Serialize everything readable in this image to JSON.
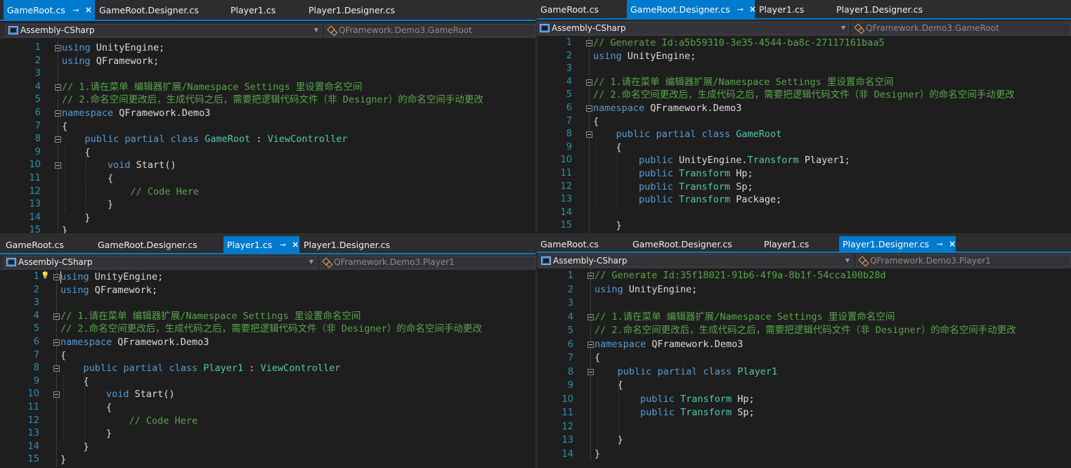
{
  "panes": [
    {
      "id": "top-left",
      "tabs": [
        {
          "label": "GameRoot.cs",
          "active": true
        },
        {
          "label": "GameRoot.Designer.cs",
          "active": false
        },
        {
          "label": "Player1.cs",
          "active": false
        },
        {
          "label": "Player1.Designer.cs",
          "active": false
        }
      ],
      "project_dropdown": "Assembly-CSharp",
      "class_dropdown": "QFramework.Demo3.GameRoot",
      "lines": [
        {
          "n": "1",
          "tokens": [
            [
              "kw",
              "using"
            ],
            [
              "plain",
              " UnityEngine;"
            ]
          ]
        },
        {
          "n": "2",
          "tokens": [
            [
              "kw",
              "using"
            ],
            [
              "plain",
              " QFramework;"
            ]
          ]
        },
        {
          "n": "3",
          "tokens": []
        },
        {
          "n": "4",
          "tokens": [
            [
              "cmt",
              "// 1.请在菜单 编辑器扩展/Namespace Settings 里设置命名空间"
            ]
          ]
        },
        {
          "n": "5",
          "tokens": [
            [
              "cmt",
              "// 2.命名空间更改后，生成代码之后，需要把逻辑代码文件（非 Designer）的命名空间手动更改"
            ]
          ]
        },
        {
          "n": "6",
          "tokens": [
            [
              "kw",
              "namespace"
            ],
            [
              "plain",
              " QFramework.Demo3"
            ]
          ]
        },
        {
          "n": "7",
          "tokens": [
            [
              "plain",
              "{"
            ]
          ]
        },
        {
          "n": "8",
          "tokens": [
            [
              "plain",
              "    "
            ],
            [
              "kw",
              "public"
            ],
            [
              "plain",
              " "
            ],
            [
              "kw",
              "partial"
            ],
            [
              "plain",
              " "
            ],
            [
              "kw",
              "class"
            ],
            [
              "plain",
              " "
            ],
            [
              "type",
              "GameRoot"
            ],
            [
              "plain",
              " : "
            ],
            [
              "type",
              "ViewController"
            ]
          ]
        },
        {
          "n": "9",
          "tokens": [
            [
              "plain",
              "    {"
            ]
          ]
        },
        {
          "n": "10",
          "tokens": [
            [
              "plain",
              "        "
            ],
            [
              "kw",
              "void"
            ],
            [
              "plain",
              " Start()"
            ]
          ]
        },
        {
          "n": "11",
          "tokens": [
            [
              "plain",
              "        {"
            ]
          ]
        },
        {
          "n": "12",
          "tokens": [
            [
              "plain",
              "            "
            ],
            [
              "cmt",
              "// Code Here"
            ]
          ]
        },
        {
          "n": "13",
          "tokens": [
            [
              "plain",
              "        }"
            ]
          ]
        },
        {
          "n": "14",
          "tokens": [
            [
              "plain",
              "    }"
            ]
          ]
        },
        {
          "n": "15",
          "tokens": [
            [
              "plain",
              "}"
            ]
          ]
        }
      ]
    },
    {
      "id": "top-right",
      "tabs": [
        {
          "label": "GameRoot.cs",
          "active": false
        },
        {
          "label": "GameRoot.Designer.cs",
          "active": true
        },
        {
          "label": "Player1.cs",
          "active": false
        },
        {
          "label": "Player1.Designer.cs",
          "active": false
        }
      ],
      "project_dropdown": "Assembly-CSharp",
      "class_dropdown": "QFramework.Demo3.GameRoot",
      "lines": [
        {
          "n": "1",
          "tokens": [
            [
              "cmt",
              "// Generate Id:a5b59310-3e35-4544-ba8c-27117161baa5"
            ]
          ]
        },
        {
          "n": "2",
          "tokens": [
            [
              "kw",
              "using"
            ],
            [
              "plain",
              " UnityEngine;"
            ]
          ]
        },
        {
          "n": "3",
          "tokens": []
        },
        {
          "n": "4",
          "tokens": [
            [
              "cmt",
              "// 1.请在菜单 编辑器扩展/Namespace Settings 里设置命名空间"
            ]
          ]
        },
        {
          "n": "5",
          "tokens": [
            [
              "cmt",
              "// 2.命名空间更改后，生成代码之后，需要把逻辑代码文件（非 Designer）的命名空间手动更改"
            ]
          ]
        },
        {
          "n": "6",
          "tokens": [
            [
              "kw",
              "namespace"
            ],
            [
              "plain",
              " QFramework.Demo3"
            ]
          ]
        },
        {
          "n": "7",
          "tokens": [
            [
              "plain",
              "{"
            ]
          ]
        },
        {
          "n": "8",
          "tokens": [
            [
              "plain",
              "    "
            ],
            [
              "kw",
              "public"
            ],
            [
              "plain",
              " "
            ],
            [
              "kw",
              "partial"
            ],
            [
              "plain",
              " "
            ],
            [
              "kw",
              "class"
            ],
            [
              "plain",
              " "
            ],
            [
              "type",
              "GameRoot"
            ]
          ]
        },
        {
          "n": "9",
          "tokens": [
            [
              "plain",
              "    {"
            ]
          ]
        },
        {
          "n": "10",
          "tokens": [
            [
              "plain",
              "        "
            ],
            [
              "kw",
              "public"
            ],
            [
              "plain",
              " UnityEngine."
            ],
            [
              "type",
              "Transform"
            ],
            [
              "plain",
              " Player1;"
            ]
          ]
        },
        {
          "n": "11",
          "tokens": [
            [
              "plain",
              "        "
            ],
            [
              "kw",
              "public"
            ],
            [
              "plain",
              " "
            ],
            [
              "type",
              "Transform"
            ],
            [
              "plain",
              " Hp;"
            ]
          ]
        },
        {
          "n": "12",
          "tokens": [
            [
              "plain",
              "        "
            ],
            [
              "kw",
              "public"
            ],
            [
              "plain",
              " "
            ],
            [
              "type",
              "Transform"
            ],
            [
              "plain",
              " Sp;"
            ]
          ]
        },
        {
          "n": "13",
          "tokens": [
            [
              "plain",
              "        "
            ],
            [
              "kw",
              "public"
            ],
            [
              "plain",
              " "
            ],
            [
              "type",
              "Transform"
            ],
            [
              "plain",
              " Package;"
            ]
          ]
        },
        {
          "n": "14",
          "tokens": []
        },
        {
          "n": "15",
          "tokens": [
            [
              "plain",
              "    }"
            ]
          ]
        }
      ]
    },
    {
      "id": "bottom-left",
      "tabs": [
        {
          "label": "GameRoot.cs",
          "active": false
        },
        {
          "label": "GameRoot.Designer.cs",
          "active": false
        },
        {
          "label": "Player1.cs",
          "active": true
        },
        {
          "label": "Player1.Designer.cs",
          "active": false
        }
      ],
      "project_dropdown": "Assembly-CSharp",
      "class_dropdown": "QFramework.Demo3.Player1",
      "lines": [
        {
          "n": "1",
          "tokens": [
            [
              "kw",
              "using"
            ],
            [
              "plain",
              " UnityEngine;"
            ]
          ]
        },
        {
          "n": "2",
          "tokens": [
            [
              "kw",
              "using"
            ],
            [
              "plain",
              " QFramework;"
            ]
          ]
        },
        {
          "n": "3",
          "tokens": []
        },
        {
          "n": "4",
          "tokens": [
            [
              "cmt",
              "// 1.请在菜单 编辑器扩展/Namespace Settings 里设置命名空间"
            ]
          ]
        },
        {
          "n": "5",
          "tokens": [
            [
              "cmt",
              "// 2.命名空间更改后，生成代码之后，需要把逻辑代码文件（非 Designer）的命名空间手动更改"
            ]
          ]
        },
        {
          "n": "6",
          "tokens": [
            [
              "kw",
              "namespace"
            ],
            [
              "plain",
              " QFramework.Demo3"
            ]
          ]
        },
        {
          "n": "7",
          "tokens": [
            [
              "plain",
              "{"
            ]
          ]
        },
        {
          "n": "8",
          "tokens": [
            [
              "plain",
              "    "
            ],
            [
              "kw",
              "public"
            ],
            [
              "plain",
              " "
            ],
            [
              "kw",
              "partial"
            ],
            [
              "plain",
              " "
            ],
            [
              "kw",
              "class"
            ],
            [
              "plain",
              " "
            ],
            [
              "type",
              "Player1"
            ],
            [
              "plain",
              " : "
            ],
            [
              "type",
              "ViewController"
            ]
          ]
        },
        {
          "n": "9",
          "tokens": [
            [
              "plain",
              "    {"
            ]
          ]
        },
        {
          "n": "10",
          "tokens": [
            [
              "plain",
              "        "
            ],
            [
              "kw",
              "void"
            ],
            [
              "plain",
              " Start()"
            ]
          ]
        },
        {
          "n": "11",
          "tokens": [
            [
              "plain",
              "        {"
            ]
          ]
        },
        {
          "n": "12",
          "tokens": [
            [
              "plain",
              "            "
            ],
            [
              "cmt",
              "// Code Here"
            ]
          ]
        },
        {
          "n": "13",
          "tokens": [
            [
              "plain",
              "        }"
            ]
          ]
        },
        {
          "n": "14",
          "tokens": [
            [
              "plain",
              "    }"
            ]
          ]
        },
        {
          "n": "15",
          "tokens": [
            [
              "plain",
              "}"
            ]
          ]
        }
      ]
    },
    {
      "id": "bottom-right",
      "tabs": [
        {
          "label": "GameRoot.cs",
          "active": false
        },
        {
          "label": "GameRoot.Designer.cs",
          "active": false
        },
        {
          "label": "Player1.cs",
          "active": false
        },
        {
          "label": "Player1.Designer.cs",
          "active": true
        }
      ],
      "project_dropdown": "Assembly-CSharp",
      "class_dropdown": "QFramework.Demo3.Player1",
      "lines": [
        {
          "n": "1",
          "tokens": [
            [
              "cmt",
              "// Generate Id:35f18021-91b6-4f9a-8b1f-54cca100b28d"
            ]
          ]
        },
        {
          "n": "2",
          "tokens": [
            [
              "kw",
              "using"
            ],
            [
              "plain",
              " UnityEngine;"
            ]
          ]
        },
        {
          "n": "3",
          "tokens": []
        },
        {
          "n": "4",
          "tokens": [
            [
              "cmt",
              "// 1.请在菜单 编辑器扩展/Namespace Settings 里设置命名空间"
            ]
          ]
        },
        {
          "n": "5",
          "tokens": [
            [
              "cmt",
              "// 2.命名空间更改后，生成代码之后，需要把逻辑代码文件（非 Designer）的命名空间手动更改"
            ]
          ]
        },
        {
          "n": "6",
          "tokens": [
            [
              "kw",
              "namespace"
            ],
            [
              "plain",
              " QFramework.Demo3"
            ]
          ]
        },
        {
          "n": "7",
          "tokens": [
            [
              "plain",
              "{"
            ]
          ]
        },
        {
          "n": "8",
          "tokens": [
            [
              "plain",
              "    "
            ],
            [
              "kw",
              "public"
            ],
            [
              "plain",
              " "
            ],
            [
              "kw",
              "partial"
            ],
            [
              "plain",
              " "
            ],
            [
              "kw",
              "class"
            ],
            [
              "plain",
              " "
            ],
            [
              "type",
              "Player1"
            ]
          ]
        },
        {
          "n": "9",
          "tokens": [
            [
              "plain",
              "    {"
            ]
          ]
        },
        {
          "n": "10",
          "tokens": [
            [
              "plain",
              "        "
            ],
            [
              "kw",
              "public"
            ],
            [
              "plain",
              " "
            ],
            [
              "type",
              "Transform"
            ],
            [
              "plain",
              " Hp;"
            ]
          ]
        },
        {
          "n": "11",
          "tokens": [
            [
              "plain",
              "        "
            ],
            [
              "kw",
              "public"
            ],
            [
              "plain",
              " "
            ],
            [
              "type",
              "Transform"
            ],
            [
              "plain",
              " Sp;"
            ]
          ]
        },
        {
          "n": "12",
          "tokens": []
        },
        {
          "n": "13",
          "tokens": [
            [
              "plain",
              "    }"
            ]
          ]
        },
        {
          "n": "14",
          "tokens": [
            [
              "plain",
              "}"
            ]
          ]
        }
      ]
    }
  ],
  "colors": {
    "editor_bg": "#1e1e1e",
    "chrome_bg": "#2d2d30",
    "accent": "#007acc",
    "keyword": "#569cd6",
    "type": "#4ec9b0",
    "comment": "#57a64a",
    "text": "#dcdcdc",
    "line_number": "#2b91af"
  },
  "icons": {
    "pin": "pin-icon",
    "close": "close-icon",
    "project": "csharp-project-icon",
    "class": "class-icon",
    "lightbulb": "lightbulb-icon"
  }
}
